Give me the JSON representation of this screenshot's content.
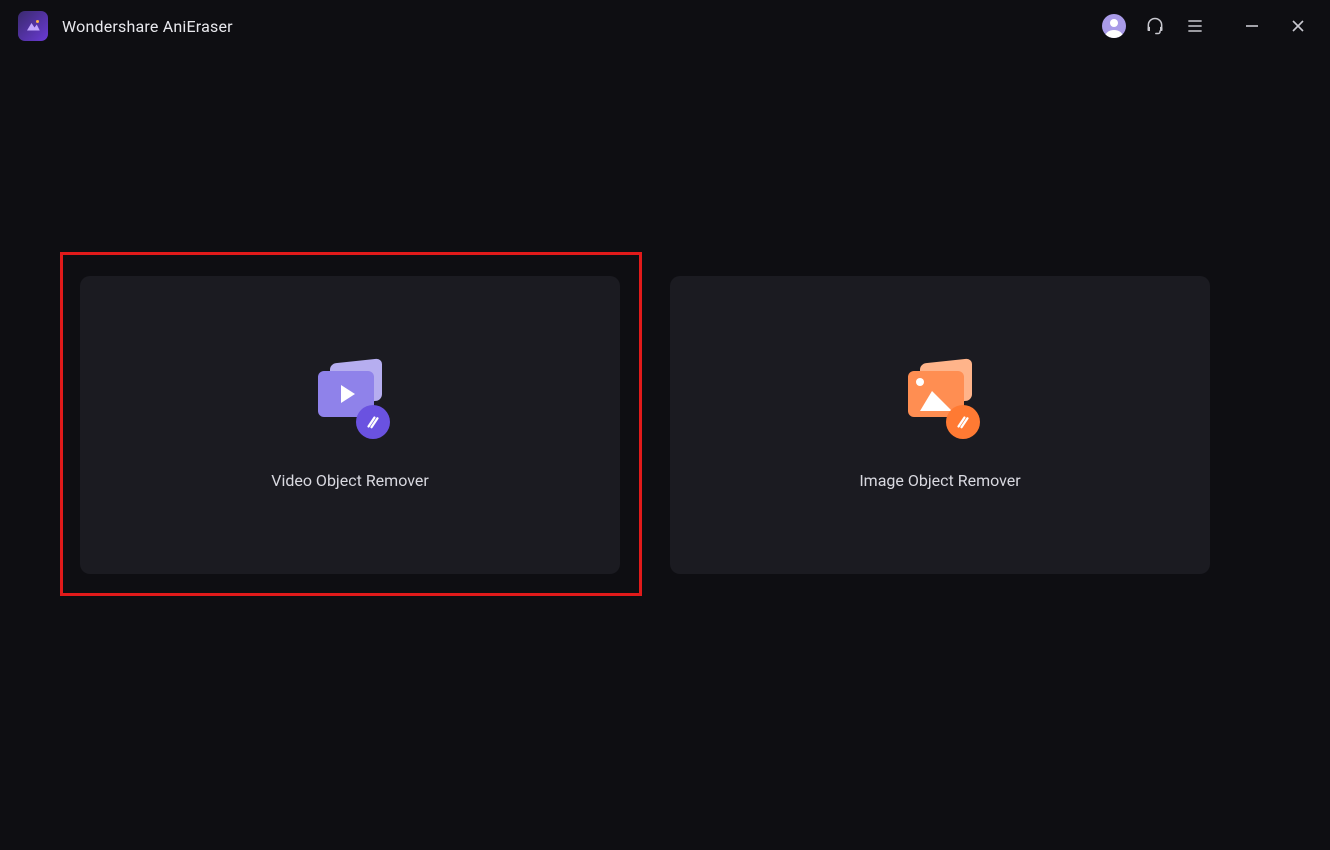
{
  "app": {
    "title": "Wondershare AniEraser"
  },
  "titlebar": {
    "avatar_icon": "user-avatar",
    "support_icon": "headset",
    "menu_icon": "hamburger",
    "minimize_icon": "minimize",
    "close_icon": "close"
  },
  "cards": [
    {
      "id": "video-object-remover",
      "label": "Video Object Remover",
      "icon": "video-eraser",
      "accent": "#6a52e0",
      "highlighted": true
    },
    {
      "id": "image-object-remover",
      "label": "Image Object Remover",
      "icon": "image-eraser",
      "accent": "#ff7a33",
      "highlighted": false
    }
  ],
  "colors": {
    "background": "#0e0e12",
    "card_bg": "#1b1b21",
    "text": "#d9d9e0",
    "highlight_border": "#e11a1a",
    "video_accent": "#8f82ea",
    "image_accent": "#ff8e52"
  }
}
